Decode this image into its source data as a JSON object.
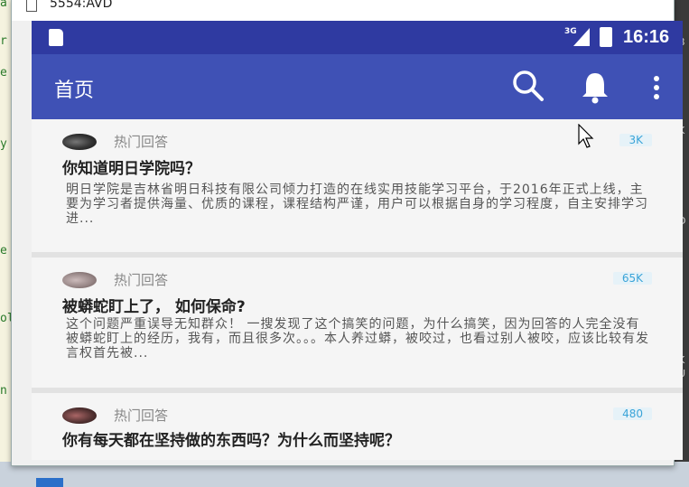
{
  "window": {
    "title": "5554:AVD"
  },
  "background": {
    "left_chars": [
      "a",
      "r",
      "e",
      "y",
      "e",
      "ol",
      "n"
    ],
    "right_chars": [
      "B",
      "K",
      "D",
      "K",
      "U"
    ]
  },
  "statusbar": {
    "network": "3G",
    "time": "16:16"
  },
  "appbar": {
    "title": "首页",
    "search_icon": "search-icon",
    "bell_icon": "bell-icon",
    "more_icon": "more-vert-icon"
  },
  "colors": {
    "statusbar": "#2f3aa1",
    "appbar": "#3f51b5",
    "count_text": "#3aa4d8"
  },
  "feed": [
    {
      "tag": "热门回答",
      "count": "3K",
      "title": "你知道明日学院吗？",
      "excerpt": "明日学院是吉林省明日科技有限公司倾力打造的在线实用技能学习平台，于2016年正式上线，主要为学习者提供海量、优质的课程，课程结构严谨，用户可以根据自身的学习程度，自主安排学习进..."
    },
    {
      "tag": "热门回答",
      "count": "65K",
      "title": "被蟒蛇盯上了，  如何保命?",
      "excerpt": "这个问题严重误导无知群众！ 一搜发现了这个搞笑的问题，为什么搞笑，因为回答的人完全没有被蟒蛇盯上的经历，我有，而且很多次。。。本人养过蟒，被咬过，也看过别人被咬，应该比较有发言权首先被..."
    },
    {
      "tag": "热门回答",
      "count": "480",
      "title": "你有每天都在坚持做的东西吗？为什么而坚持呢？",
      "excerpt": ""
    }
  ]
}
